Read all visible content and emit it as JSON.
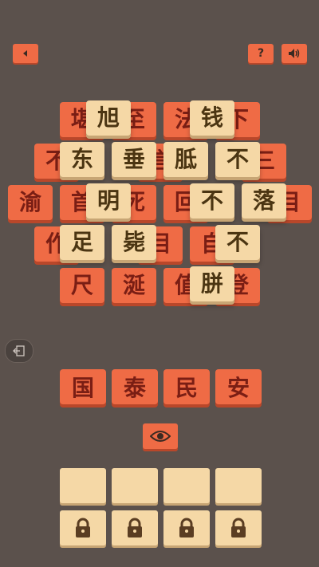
{
  "toolbar": {
    "back_icon": "triangle-left-icon",
    "help_label": "?",
    "sound_icon": "speaker-icon"
  },
  "puzzle": {
    "red_tiles": [
      "堪",
      "至",
      "法",
      "下",
      "不",
      "言",
      "三",
      "渝",
      "首",
      "死",
      "回",
      "目",
      "作",
      "目",
      "自",
      "尺",
      "涎",
      "值",
      "登"
    ],
    "light_tiles": [
      "旭",
      "钱",
      "东",
      "垂",
      "胝",
      "不",
      "明",
      "不",
      "落",
      "足",
      "毙",
      "不",
      "胼"
    ]
  },
  "answer": [
    "国",
    "泰",
    "民",
    "安"
  ],
  "hint_icon": "eye-icon",
  "exit_icon": "exit-icon",
  "colors": {
    "background": "#5b514c",
    "tile_red": "#ef6b45",
    "tile_light": "#f5d8a6",
    "text_dark_red": "#7a1e14",
    "text_dark_brown": "#4b3512"
  }
}
